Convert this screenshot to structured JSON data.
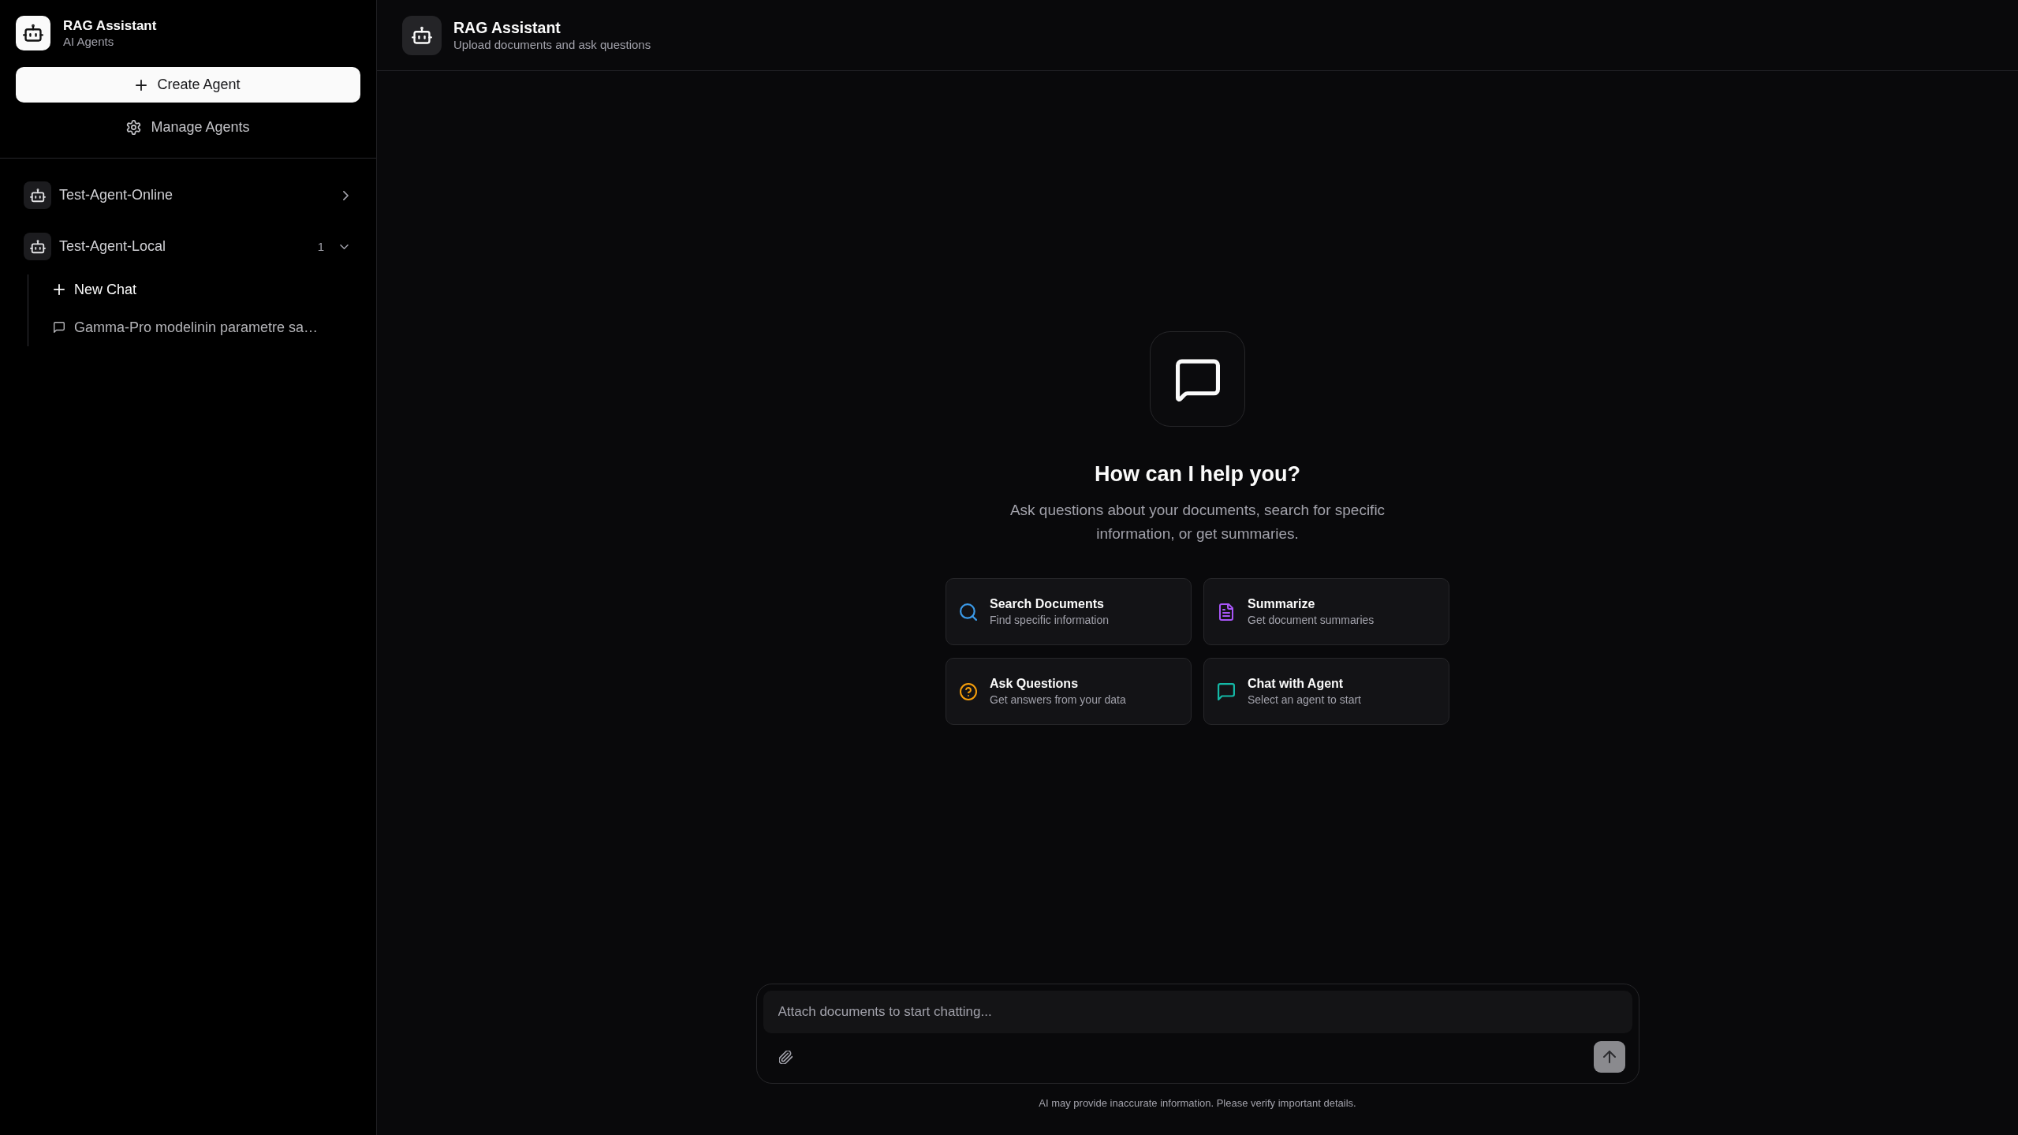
{
  "sidebar": {
    "brand": {
      "title": "RAG Assistant",
      "subtitle": "AI Agents"
    },
    "create_button": "Create Agent",
    "manage_button": "Manage Agents",
    "agents": [
      {
        "name": "Test-Agent-Online",
        "expanded": false
      },
      {
        "name": "Test-Agent-Local",
        "count": "1",
        "expanded": true,
        "chats": [
          {
            "kind": "new",
            "label": "New Chat"
          },
          {
            "kind": "chat",
            "label": "Gamma-Pro modelinin parametre sa…"
          }
        ]
      }
    ]
  },
  "header": {
    "title": "RAG Assistant",
    "subtitle": "Upload documents and ask questions"
  },
  "welcome": {
    "heading": "How can I help you?",
    "text": "Ask questions about your documents, search for specific information, or get summaries.",
    "actions": [
      {
        "kind": "search",
        "title": "Search Documents",
        "subtitle": "Find specific information",
        "color": "#3b9ae8"
      },
      {
        "kind": "summarize",
        "title": "Summarize",
        "subtitle": "Get document summaries",
        "color": "#a855f7"
      },
      {
        "kind": "ask",
        "title": "Ask Questions",
        "subtitle": "Get answers from your data",
        "color": "#f59e0b"
      },
      {
        "kind": "chat",
        "title": "Chat with Agent",
        "subtitle": "Select an agent to start",
        "color": "#14b8a6"
      }
    ]
  },
  "composer": {
    "placeholder": "Attach documents to start chatting...",
    "send_disabled": true
  },
  "disclaimer": "AI may provide inaccurate information. Please verify important details."
}
